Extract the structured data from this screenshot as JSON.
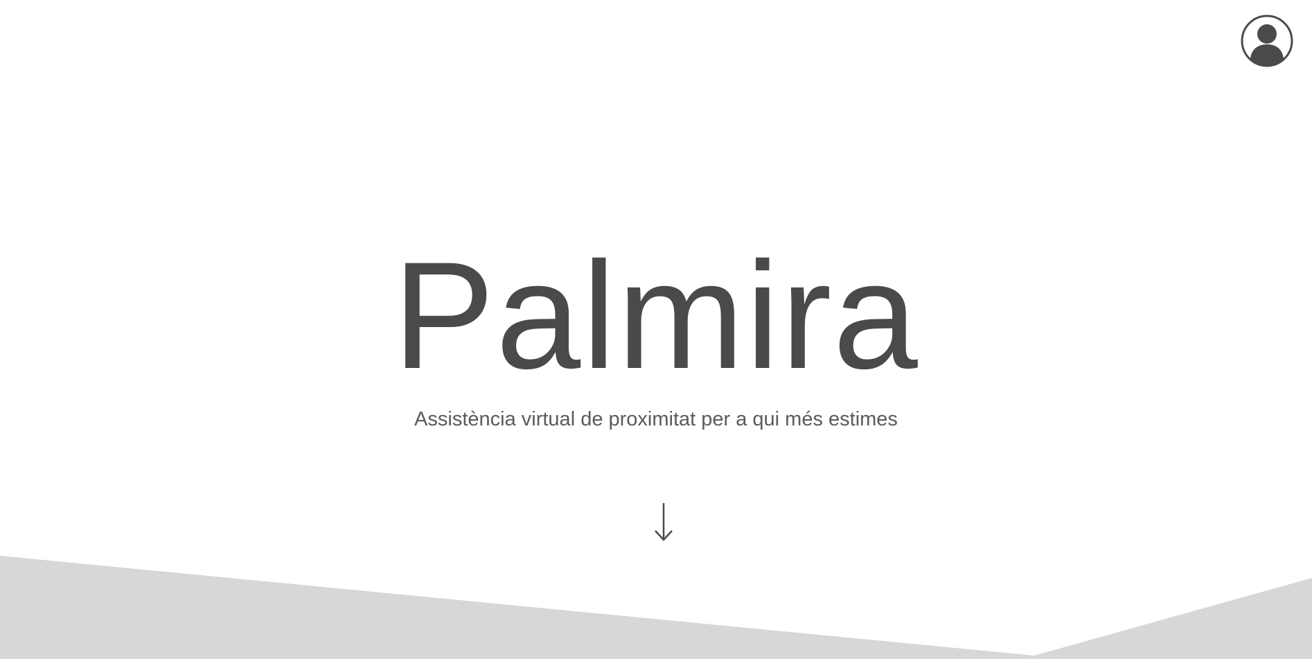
{
  "header": {
    "account_icon": "user-account-icon"
  },
  "hero": {
    "title": "Palmira",
    "subtitle": "Assistència virtual de proximitat per a qui més estimes"
  },
  "scroll": {
    "icon": "arrow-down-icon"
  },
  "colors": {
    "background": "#ffffff",
    "text": "#4a4a4a",
    "subtitle": "#5a5a5a",
    "band": "#d7d7d7"
  }
}
